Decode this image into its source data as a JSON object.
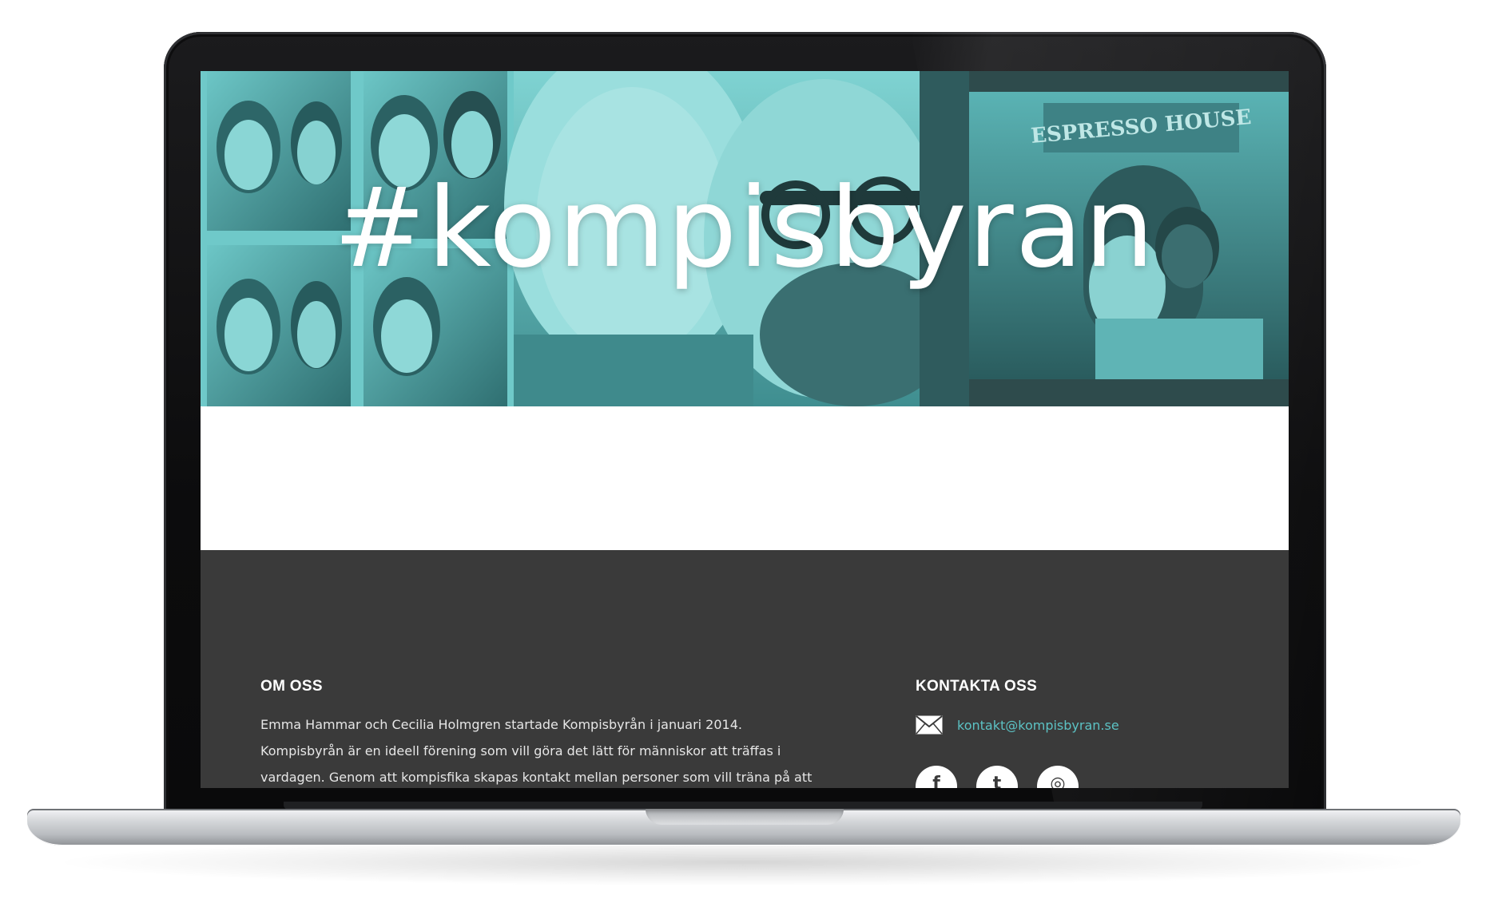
{
  "hero": {
    "title": "#kompisbyran",
    "storefront_sign": "ESPRESSO HOUSE"
  },
  "footer": {
    "about": {
      "heading": "OM OSS",
      "text": "Emma Hammar och Cecilia Holmgren startade Kompisbyrån i januari 2014. Kompisbyrån är en ideell förening som vill göra det lätt för människor att träffas i vardagen. Genom att kompisfika skapas kontakt mellan personer som vill träna på att"
    },
    "contact": {
      "heading": "KONTAKTA OSS",
      "email": "kontakt@kompisbyran.se",
      "icons": [
        "mail-icon",
        "facebook-icon",
        "twitter-icon",
        "instagram-icon"
      ]
    }
  },
  "colors": {
    "hero_tint": "#6fc9c9",
    "hero_dark": "#2e4b4c",
    "footer_bg": "#3a3a3a",
    "link": "#5cc2c4"
  }
}
